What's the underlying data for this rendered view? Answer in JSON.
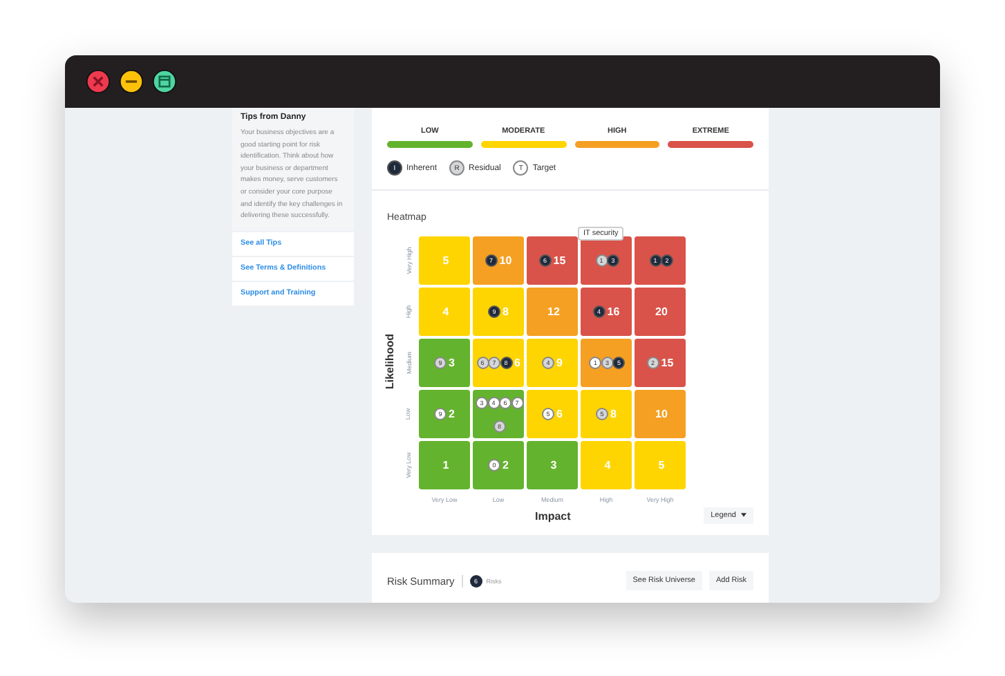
{
  "window_controls": [
    {
      "kind": "close"
    },
    {
      "kind": "minimize"
    },
    {
      "kind": "maximize"
    }
  ],
  "sidebar": {
    "title": "Tips from Danny",
    "text": "Your business objectives are a good starting point for risk identification. Think about how your business or department makes money, serve customers or consider your core purpose and identify the key challenges in delivering these successfully.",
    "links": [
      "See all Tips",
      "See Terms & Definitions",
      "Support and Training"
    ]
  },
  "rating_scale": [
    {
      "label": "LOW",
      "color": "#64b32e"
    },
    {
      "label": "MODERATE",
      "color": "#fed500"
    },
    {
      "label": "HIGH",
      "color": "#f5a023"
    },
    {
      "label": "EXTREME",
      "color": "#d9534a"
    }
  ],
  "marker_key": [
    {
      "symbol": "I",
      "label": "Inherent",
      "kind": "inherent"
    },
    {
      "symbol": "R",
      "label": "Residual",
      "kind": "residual"
    },
    {
      "symbol": "T",
      "label": "Target",
      "kind": "target"
    }
  ],
  "heatmap": {
    "title": "Heatmap",
    "y_axis_label": "Likelihood",
    "x_axis_label": "Impact",
    "row_labels": [
      "Very High",
      "High",
      "Medium",
      "Low",
      "Very Low"
    ],
    "column_labels": [
      "Very Low",
      "Low",
      "Medium",
      "High",
      "Very High"
    ],
    "rows": [
      [
        {
          "score": "5",
          "color": "#fed500"
        },
        {
          "score": "10",
          "color": "#f5a023",
          "markers": [
            {
              "label": "7",
              "kind": "inherent"
            }
          ]
        },
        {
          "score": "15",
          "color": "#d9534a",
          "markers": [
            {
              "label": "6",
              "kind": "inherent"
            }
          ]
        },
        {
          "color": "#d9534a",
          "tooltip": "IT security",
          "markers": [
            {
              "label": "1",
              "kind": "residual"
            },
            {
              "label": "3",
              "kind": "inherent"
            }
          ]
        },
        {
          "color": "#d9534a",
          "markers": [
            {
              "label": "1",
              "kind": "inherent"
            },
            {
              "label": "2",
              "kind": "inherent"
            }
          ]
        }
      ],
      [
        {
          "score": "4",
          "color": "#fed500"
        },
        {
          "score": "8",
          "color": "#fed500",
          "markers": [
            {
              "label": "9",
              "kind": "inherent"
            }
          ]
        },
        {
          "score": "12",
          "color": "#f5a023"
        },
        {
          "score": "16",
          "color": "#d9534a",
          "markers": [
            {
              "label": "4",
              "kind": "inherent"
            }
          ]
        },
        {
          "score": "20",
          "color": "#d9534a"
        }
      ],
      [
        {
          "score": "3",
          "color": "#64b32e",
          "markers": [
            {
              "label": "9",
              "kind": "residual"
            }
          ]
        },
        {
          "score": "6",
          "color": "#fed500",
          "markers": [
            {
              "label": "6",
              "kind": "residual"
            },
            {
              "label": "7",
              "kind": "residual"
            },
            {
              "label": "8",
              "kind": "inherent"
            }
          ]
        },
        {
          "score": "9",
          "color": "#fed500",
          "markers": [
            {
              "label": "4",
              "kind": "residual"
            }
          ]
        },
        {
          "color": "#f5a023",
          "markers": [
            {
              "label": "1",
              "kind": "target"
            },
            {
              "label": "3",
              "kind": "residual"
            },
            {
              "label": "5",
              "kind": "inherent"
            }
          ]
        },
        {
          "score": "15",
          "color": "#d9534a",
          "markers": [
            {
              "label": "2",
              "kind": "residual"
            }
          ]
        }
      ],
      [
        {
          "score": "2",
          "color": "#64b32e",
          "markers": [
            {
              "label": "9",
              "kind": "target"
            }
          ]
        },
        {
          "color": "#64b32e",
          "markers": [
            {
              "label": "3",
              "kind": "target"
            },
            {
              "label": "4",
              "kind": "target"
            },
            {
              "label": "6",
              "kind": "target"
            },
            {
              "label": "7",
              "kind": "target"
            },
            {
              "label": "8",
              "kind": "residual"
            }
          ]
        },
        {
          "score": "6",
          "color": "#fed500",
          "markers": [
            {
              "label": "5",
              "kind": "target"
            }
          ]
        },
        {
          "score": "8",
          "color": "#fed500",
          "markers": [
            {
              "label": "5",
              "kind": "residual"
            }
          ]
        },
        {
          "score": "10",
          "color": "#f5a023"
        }
      ],
      [
        {
          "score": "1",
          "color": "#64b32e"
        },
        {
          "score": "2",
          "color": "#64b32e",
          "markers": [
            {
              "label": "0",
              "kind": "target"
            }
          ]
        },
        {
          "score": "3",
          "color": "#64b32e"
        },
        {
          "score": "4",
          "color": "#fed500"
        },
        {
          "score": "5",
          "color": "#fed500"
        }
      ]
    ],
    "legend_button": "Legend"
  },
  "risk_summary": {
    "title": "Risk Summary",
    "count": "6",
    "count_label": "Risks",
    "buttons": [
      "See Risk Universe",
      "Add Risk"
    ]
  }
}
